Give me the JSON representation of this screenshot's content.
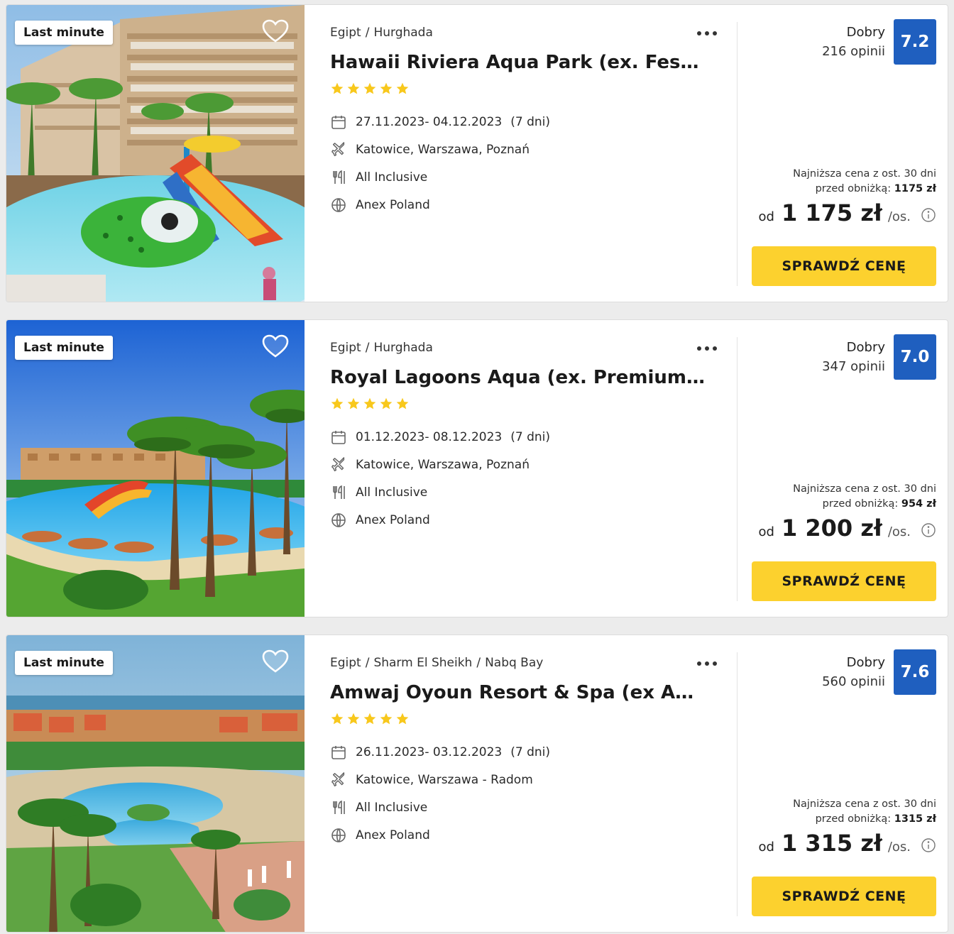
{
  "colors": {
    "accent_yellow": "#fcd12e",
    "score_blue": "#1f5fbf",
    "star_yellow": "#f8c81c"
  },
  "offers": [
    {
      "badge": "Last minute",
      "breadcrumb": [
        "Egipt",
        "Hurghada"
      ],
      "name": "Hawaii Riviera Aqua Park (ex. Festiva…",
      "stars": 5,
      "dates": "27.11.2023- 04.12.2023",
      "duration": "(7 dni)",
      "departures": "Katowice, Warszawa, Poznań",
      "board": "All Inclusive",
      "operator": "Anex Poland",
      "rating_word": "Dobry",
      "reviews": "216 opinii",
      "score": "7.2",
      "lowest_line1": "Najniższa cena z ost. 30 dni",
      "lowest_line2_label": "przed obniżką:",
      "lowest_line2_value": "1175 zł",
      "price_prefix": "od",
      "price": "1 175 zł",
      "price_suffix": "/os.",
      "cta": "SPRAWDŹ CENĘ"
    },
    {
      "badge": "Last minute",
      "breadcrumb": [
        "Egipt",
        "Hurghada"
      ],
      "name": "Royal Lagoons Aqua (ex. Premium Bl…",
      "stars": 5,
      "dates": "01.12.2023- 08.12.2023",
      "duration": "(7 dni)",
      "departures": "Katowice, Warszawa, Poznań",
      "board": "All Inclusive",
      "operator": "Anex Poland",
      "rating_word": "Dobry",
      "reviews": "347 opinii",
      "score": "7.0",
      "lowest_line1": "Najniższa cena z ost. 30 dni",
      "lowest_line2_label": "przed obniżką:",
      "lowest_line2_value": "954 zł",
      "price_prefix": "od",
      "price": "1 200 zł",
      "price_suffix": "/os.",
      "cta": "SPRAWDŹ CENĘ"
    },
    {
      "badge": "Last minute",
      "breadcrumb": [
        "Egipt",
        "Sharm El Sheikh",
        "Nabq Bay"
      ],
      "name": "Amwaj Oyoun Resort & Spa (ex AA A…",
      "stars": 5,
      "dates": "26.11.2023- 03.12.2023",
      "duration": "(7 dni)",
      "departures": "Katowice, Warszawa - Radom",
      "board": "All Inclusive",
      "operator": "Anex Poland",
      "rating_word": "Dobry",
      "reviews": "560 opinii",
      "score": "7.6",
      "lowest_line1": "Najniższa cena z ost. 30 dni",
      "lowest_line2_label": "przed obniżką:",
      "lowest_line2_value": "1315 zł",
      "price_prefix": "od",
      "price": "1 315 zł",
      "price_suffix": "/os.",
      "cta": "SPRAWDŹ CENĘ"
    }
  ]
}
